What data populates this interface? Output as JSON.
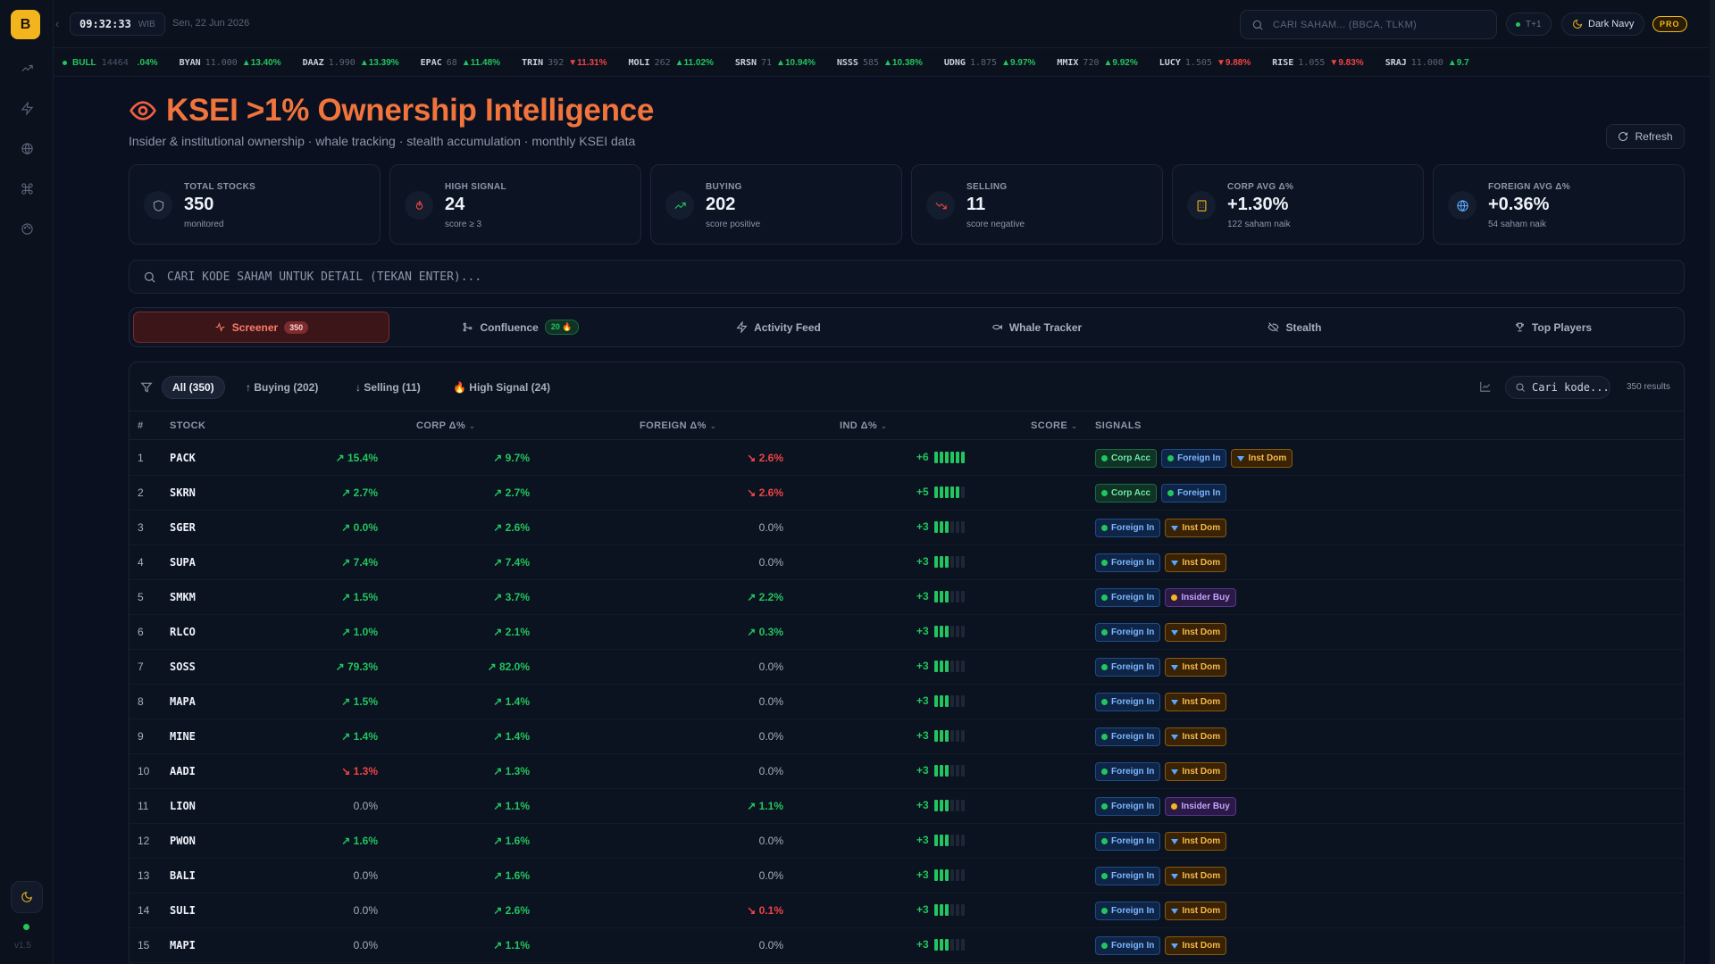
{
  "app": {
    "logo_letter": "B",
    "version": "v1.5",
    "clock_time": "09:32:33",
    "clock_tz": "WIB",
    "date": "Sen, 22 Jun 2026",
    "global_search_placeholder": "CARI SAHAM... (BBCA, TLKM)",
    "settlement_label": "T+1",
    "theme_label": "Dark Navy",
    "plan_badge": "PRO"
  },
  "ticker": {
    "market_label": "BULL",
    "market_value": "14464",
    "lead_fragment": ".04%",
    "items": [
      {
        "code": "BYAN",
        "price": "11.000",
        "change": "▲13.40%",
        "dir": "up"
      },
      {
        "code": "DAAZ",
        "price": "1.990",
        "change": "▲13.39%",
        "dir": "up"
      },
      {
        "code": "EPAC",
        "price": "68",
        "change": "▲11.48%",
        "dir": "up"
      },
      {
        "code": "TRIN",
        "price": "392",
        "change": "▼11.31%",
        "dir": "dn"
      },
      {
        "code": "MOLI",
        "price": "262",
        "change": "▲11.02%",
        "dir": "up"
      },
      {
        "code": "SRSN",
        "price": "71",
        "change": "▲10.94%",
        "dir": "up"
      },
      {
        "code": "NSSS",
        "price": "585",
        "change": "▲10.38%",
        "dir": "up"
      },
      {
        "code": "UDNG",
        "price": "1.875",
        "change": "▲9.97%",
        "dir": "up"
      },
      {
        "code": "MMIX",
        "price": "720",
        "change": "▲9.92%",
        "dir": "up"
      },
      {
        "code": "LUCY",
        "price": "1.505",
        "change": "▼9.88%",
        "dir": "dn"
      },
      {
        "code": "RISE",
        "price": "1.055",
        "change": "▼9.83%",
        "dir": "dn"
      },
      {
        "code": "SRAJ",
        "price": "11.000",
        "change": "▲9.7",
        "dir": "up"
      }
    ]
  },
  "header": {
    "title": "KSEI >1% Ownership Intelligence",
    "subtitle": "Insider & institutional ownership · whale tracking · stealth accumulation · monthly KSEI data",
    "refresh_label": "Refresh"
  },
  "stats": [
    {
      "label": "TOTAL STOCKS",
      "value": "350",
      "sub": "monitored",
      "icon": "shield-icon",
      "color": "#8d97a8"
    },
    {
      "label": "HIGH SIGNAL",
      "value": "24",
      "sub": "score ≥ 3",
      "icon": "flame-icon",
      "color": "#ef4444"
    },
    {
      "label": "BUYING",
      "value": "202",
      "sub": "score positive",
      "icon": "trend-up-icon",
      "color": "#22c55e"
    },
    {
      "label": "SELLING",
      "value": "11",
      "sub": "score negative",
      "icon": "trend-down-icon",
      "color": "#ef4444"
    },
    {
      "label": "CORP AVG Δ%",
      "value": "+1.30%",
      "sub": "122 saham naik",
      "icon": "building-icon",
      "color": "#f2b51e"
    },
    {
      "label": "FOREIGN AVG Δ%",
      "value": "+0.36%",
      "sub": "54 saham naik",
      "icon": "globe-icon",
      "color": "#5aa9ff"
    }
  ],
  "detail_search_placeholder": "CARI KODE SAHAM UNTUK DETAIL (TEKAN ENTER)...",
  "tabs": [
    {
      "label": "Screener",
      "badge": "350",
      "active": true
    },
    {
      "label": "Confluence",
      "badge": "20 🔥",
      "active": false
    },
    {
      "label": "Activity Feed",
      "badge": "",
      "active": false
    },
    {
      "label": "Whale Tracker",
      "badge": "",
      "active": false
    },
    {
      "label": "Stealth",
      "badge": "",
      "active": false
    },
    {
      "label": "Top Players",
      "badge": "",
      "active": false
    }
  ],
  "filters": {
    "all": "All (350)",
    "buying": "↑ Buying (202)",
    "selling": "↓ Selling (11)",
    "high_signal": "🔥 High Signal (24)",
    "search_value": "Cari kode...",
    "results": "350 results"
  },
  "columns": {
    "no": "#",
    "stock": "STOCK",
    "corp": "CORP Δ%",
    "foreign": "FOREIGN Δ%",
    "ind": "IND Δ%",
    "score": "SCORE",
    "signals": "SIGNALS"
  },
  "rows": [
    {
      "no": "1",
      "stock": "PACK",
      "corp": "↗ 15.4%",
      "corp_dir": "pos",
      "foreign": "↗ 9.7%",
      "foreign_dir": "pos",
      "ind": "↘ 2.6%",
      "ind_dir": "neg",
      "score": "+6",
      "score_level": 6,
      "signals": [
        "Corp Acc",
        "Foreign In",
        "Inst Dom"
      ]
    },
    {
      "no": "2",
      "stock": "SKRN",
      "corp": "↗ 2.7%",
      "corp_dir": "pos",
      "foreign": "↗ 2.7%",
      "foreign_dir": "pos",
      "ind": "↘ 2.6%",
      "ind_dir": "neg",
      "score": "+5",
      "score_level": 5,
      "signals": [
        "Corp Acc",
        "Foreign In"
      ]
    },
    {
      "no": "3",
      "stock": "SGER",
      "corp": "↗ 0.0%",
      "corp_dir": "pos",
      "foreign": "↗ 2.6%",
      "foreign_dir": "pos",
      "ind": "0.0%",
      "ind_dir": "zero",
      "score": "+3",
      "score_level": 3,
      "signals": [
        "Foreign In",
        "Inst Dom"
      ]
    },
    {
      "no": "4",
      "stock": "SUPA",
      "corp": "↗ 7.4%",
      "corp_dir": "pos",
      "foreign": "↗ 7.4%",
      "foreign_dir": "pos",
      "ind": "0.0%",
      "ind_dir": "zero",
      "score": "+3",
      "score_level": 3,
      "signals": [
        "Foreign In",
        "Inst Dom"
      ]
    },
    {
      "no": "5",
      "stock": "SMKM",
      "corp": "↗ 1.5%",
      "corp_dir": "pos",
      "foreign": "↗ 3.7%",
      "foreign_dir": "pos",
      "ind": "↗ 2.2%",
      "ind_dir": "pos",
      "score": "+3",
      "score_level": 3,
      "signals": [
        "Foreign In",
        "Insider Buy"
      ]
    },
    {
      "no": "6",
      "stock": "RLCO",
      "corp": "↗ 1.0%",
      "corp_dir": "pos",
      "foreign": "↗ 2.1%",
      "foreign_dir": "pos",
      "ind": "↗ 0.3%",
      "ind_dir": "pos",
      "score": "+3",
      "score_level": 3,
      "signals": [
        "Foreign In",
        "Inst Dom"
      ]
    },
    {
      "no": "7",
      "stock": "SOSS",
      "corp": "↗ 79.3%",
      "corp_dir": "pos",
      "foreign": "↗ 82.0%",
      "foreign_dir": "pos",
      "ind": "0.0%",
      "ind_dir": "zero",
      "score": "+3",
      "score_level": 3,
      "signals": [
        "Foreign In",
        "Inst Dom"
      ]
    },
    {
      "no": "8",
      "stock": "MAPA",
      "corp": "↗ 1.5%",
      "corp_dir": "pos",
      "foreign": "↗ 1.4%",
      "foreign_dir": "pos",
      "ind": "0.0%",
      "ind_dir": "zero",
      "score": "+3",
      "score_level": 3,
      "signals": [
        "Foreign In",
        "Inst Dom"
      ]
    },
    {
      "no": "9",
      "stock": "MINE",
      "corp": "↗ 1.4%",
      "corp_dir": "pos",
      "foreign": "↗ 1.4%",
      "foreign_dir": "pos",
      "ind": "0.0%",
      "ind_dir": "zero",
      "score": "+3",
      "score_level": 3,
      "signals": [
        "Foreign In",
        "Inst Dom"
      ]
    },
    {
      "no": "10",
      "stock": "AADI",
      "corp": "↘ 1.3%",
      "corp_dir": "neg",
      "foreign": "↗ 1.3%",
      "foreign_dir": "pos",
      "ind": "0.0%",
      "ind_dir": "zero",
      "score": "+3",
      "score_level": 3,
      "signals": [
        "Foreign In",
        "Inst Dom"
      ]
    },
    {
      "no": "11",
      "stock": "LION",
      "corp": "0.0%",
      "corp_dir": "zero",
      "foreign": "↗ 1.1%",
      "foreign_dir": "pos",
      "ind": "↗ 1.1%",
      "ind_dir": "pos",
      "score": "+3",
      "score_level": 3,
      "signals": [
        "Foreign In",
        "Insider Buy"
      ]
    },
    {
      "no": "12",
      "stock": "PWON",
      "corp": "↗ 1.6%",
      "corp_dir": "pos",
      "foreign": "↗ 1.6%",
      "foreign_dir": "pos",
      "ind": "0.0%",
      "ind_dir": "zero",
      "score": "+3",
      "score_level": 3,
      "signals": [
        "Foreign In",
        "Inst Dom"
      ]
    },
    {
      "no": "13",
      "stock": "BALI",
      "corp": "0.0%",
      "corp_dir": "zero",
      "foreign": "↗ 1.6%",
      "foreign_dir": "pos",
      "ind": "0.0%",
      "ind_dir": "zero",
      "score": "+3",
      "score_level": 3,
      "signals": [
        "Foreign In",
        "Inst Dom"
      ]
    },
    {
      "no": "14",
      "stock": "SULI",
      "corp": "0.0%",
      "corp_dir": "zero",
      "foreign": "↗ 2.6%",
      "foreign_dir": "pos",
      "ind": "↘ 0.1%",
      "ind_dir": "neg",
      "score": "+3",
      "score_level": 3,
      "signals": [
        "Foreign In",
        "Inst Dom"
      ]
    },
    {
      "no": "15",
      "stock": "MAPI",
      "corp": "0.0%",
      "corp_dir": "zero",
      "foreign": "↗ 1.1%",
      "foreign_dir": "pos",
      "ind": "0.0%",
      "ind_dir": "zero",
      "score": "+3",
      "score_level": 3,
      "signals": [
        "Foreign In",
        "Inst Dom"
      ]
    }
  ]
}
